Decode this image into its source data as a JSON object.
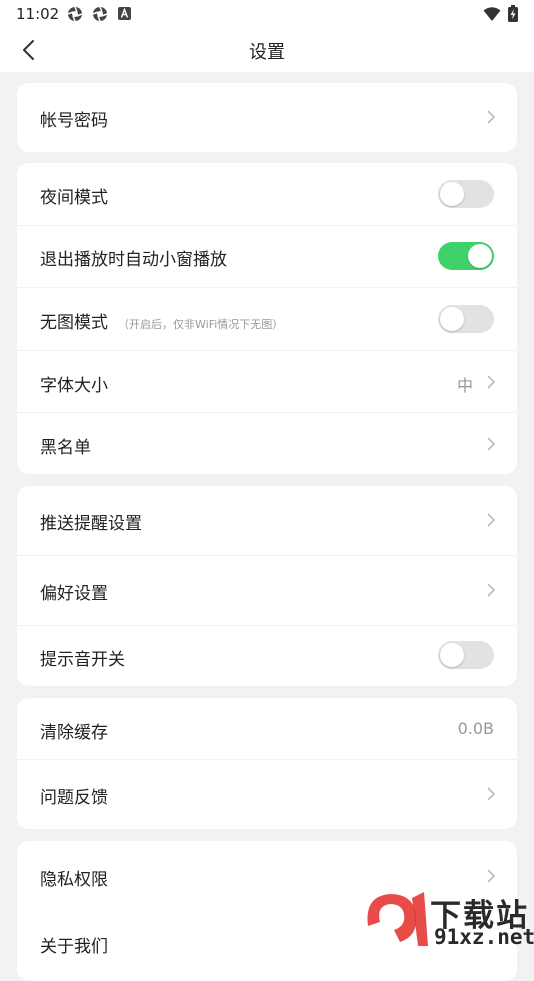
{
  "status_bar": {
    "time": "11:02",
    "icons": [
      "aperture-icon",
      "aperture-icon",
      "a-badge-icon",
      "wifi-icon",
      "battery-charging-icon"
    ]
  },
  "header": {
    "title": "设置",
    "back_icon": "chevron-left-icon"
  },
  "sections": [
    {
      "rows": [
        {
          "label": "帐号密码",
          "type": "link"
        }
      ]
    },
    {
      "rows": [
        {
          "label": "夜间模式",
          "type": "toggle",
          "on": false
        },
        {
          "label": "退出播放时自动小窗播放",
          "type": "toggle",
          "on": true
        },
        {
          "label": "无图模式",
          "note": "（开启后，仅非WiFi情况下无图）",
          "type": "toggle",
          "on": false
        },
        {
          "label": "字体大小",
          "value": "中",
          "type": "link"
        },
        {
          "label": "黑名单",
          "type": "link"
        }
      ]
    },
    {
      "rows": [
        {
          "label": "推送提醒设置",
          "type": "link"
        },
        {
          "label": "偏好设置",
          "type": "link"
        },
        {
          "label": "提示音开关",
          "type": "toggle",
          "on": false
        }
      ]
    },
    {
      "rows": [
        {
          "label": "清除缓存",
          "value": "0.0B",
          "type": "value"
        },
        {
          "label": "问题反馈",
          "type": "link"
        }
      ]
    },
    {
      "rows": [
        {
          "label": "隐私权限",
          "type": "link"
        },
        {
          "label": "关于我们",
          "type": "link"
        }
      ]
    }
  ],
  "watermark": {
    "text": "下载站",
    "url": "91xz.net",
    "accent": "#e53935"
  },
  "colors": {
    "toggle_on": "#3fd26a",
    "toggle_off": "#e2e2e2",
    "background": "#f2f2f2"
  }
}
